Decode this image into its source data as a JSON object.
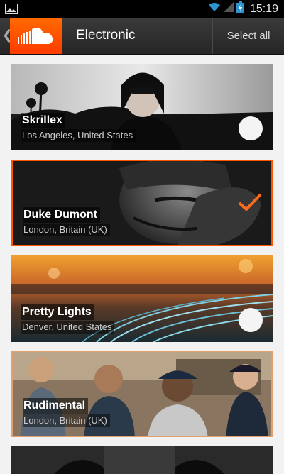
{
  "status_bar": {
    "time": "15:19"
  },
  "action_bar": {
    "title": "Electronic",
    "select_all": "Select all"
  },
  "artists": [
    {
      "name": "Skrillex",
      "location": "Los Angeles, United States",
      "selected": false
    },
    {
      "name": "Duke Dumont",
      "location": "London, Britain (UK)",
      "selected": true
    },
    {
      "name": "Pretty Lights",
      "location": "Denver, United States",
      "selected": false
    },
    {
      "name": "Rudimental",
      "location": "London, Britain (UK)",
      "selected": false
    }
  ],
  "colors": {
    "accent": "#ff5500",
    "status_bg": "#000000",
    "action_bar_bg": "#2e2e2e"
  }
}
